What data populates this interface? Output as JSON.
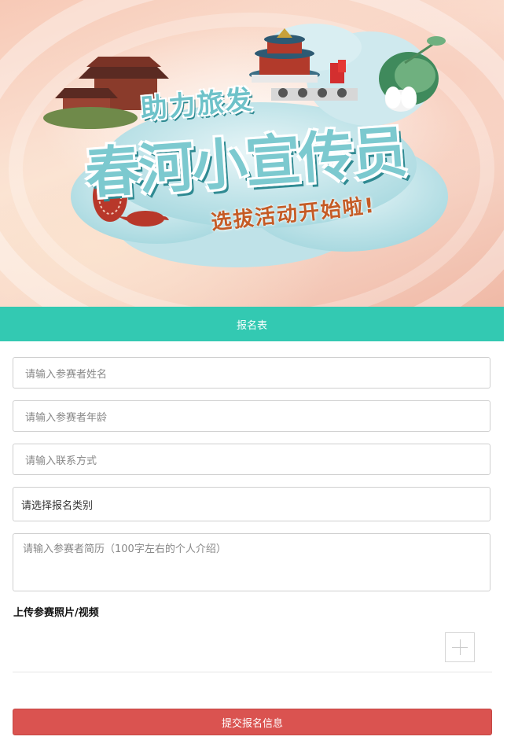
{
  "banner": {
    "title_top": "助力旅发",
    "title_main": "春河小宣传员",
    "subtitle": "选拔活动开始啦!"
  },
  "form": {
    "header": "报名表",
    "name_placeholder": "请输入参赛者姓名",
    "age_placeholder": "请输入参赛者年龄",
    "contact_placeholder": "请输入联系方式",
    "category_label": "请选择报名类别",
    "resume_placeholder": "请输入参赛者简历（100字左右的个人介绍）",
    "upload_title": "上传参赛照片/视频",
    "submit_label": "提交报名信息"
  },
  "colors": {
    "header_bg": "#33c9b2",
    "submit_bg": "#da5350"
  }
}
